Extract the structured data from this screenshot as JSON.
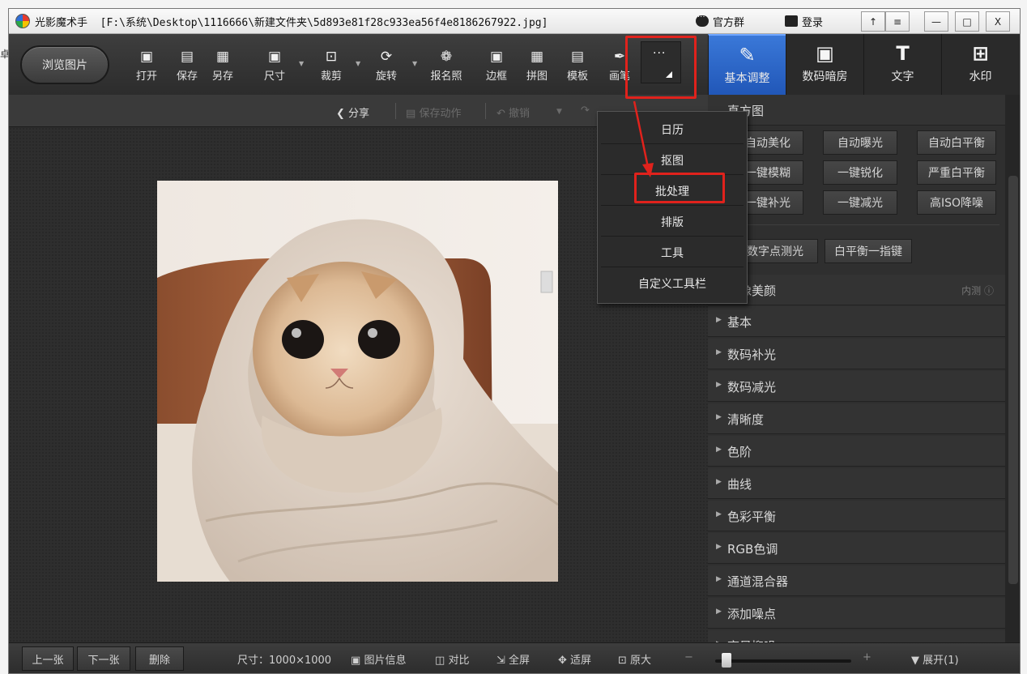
{
  "window": {
    "app_name": "光影魔术手",
    "file_path": "[F:\\系统\\Desktop\\1116666\\新建文件夹\\5d893e81f28c933ea56f4e8186267922.jpg]",
    "official_group": "官方群",
    "login": "登录",
    "controls": [
      "↑",
      "≡",
      "—",
      "□",
      "X"
    ]
  },
  "toolbar": {
    "browse": "浏览图片",
    "tools": [
      {
        "label": "打开",
        "icon": "open-icon"
      },
      {
        "label": "保存",
        "icon": "save-icon"
      },
      {
        "label": "另存",
        "icon": "save-as-icon"
      },
      {
        "label": "尺寸",
        "icon": "resize-icon"
      },
      {
        "label": "裁剪",
        "icon": "crop-icon"
      },
      {
        "label": "旋转",
        "icon": "rotate-icon"
      },
      {
        "label": "报名照",
        "icon": "id-photo-icon"
      },
      {
        "label": "边框",
        "icon": "border-icon"
      },
      {
        "label": "拼图",
        "icon": "collage-icon"
      },
      {
        "label": "模板",
        "icon": "template-icon"
      },
      {
        "label": "画笔",
        "icon": "brush-icon"
      }
    ],
    "more": "···"
  },
  "right_tabs": [
    {
      "label": "基本调整",
      "icon": "adjust-icon",
      "active": true
    },
    {
      "label": "数码暗房",
      "icon": "darkroom-icon",
      "active": false
    },
    {
      "label": "文字",
      "icon": "text-icon",
      "active": false
    },
    {
      "label": "水印",
      "icon": "watermark-icon",
      "active": false
    }
  ],
  "subbar": {
    "share": "分享",
    "save_action": "保存动作",
    "undo": "撤销"
  },
  "dropdown_menu": [
    "日历",
    "抠图",
    "批处理",
    "排版",
    "工具",
    "自定义工具栏"
  ],
  "right_panel": {
    "histogram_title": "直方图",
    "auto_buttons": [
      "自动美化",
      "自动曝光",
      "自动白平衡",
      "一键模糊",
      "一键锐化",
      "严重白平衡",
      "一键补光",
      "一键减光",
      "高ISO降噪"
    ],
    "metering_buttons": [
      "数字点测光",
      "白平衡一指键"
    ],
    "beauty_title": "人像美颜",
    "beauty_note": "内测",
    "sections": [
      "基本",
      "数码补光",
      "数码减光",
      "清晰度",
      "色阶",
      "曲线",
      "色彩平衡",
      "RGB色调",
      "通道混合器",
      "添加噪点",
      "夜景抑噪"
    ]
  },
  "bottombar": {
    "prev": "上一张",
    "next": "下一张",
    "delete": "删除",
    "size": "尺寸：1000×1000",
    "info": "图片信息",
    "compare": "对比",
    "fullscreen": "全屏",
    "fit": "适屏",
    "original": "原大",
    "zoom_minus": "−",
    "zoom_plus": "+",
    "expand": "展开(1)"
  },
  "colors": {
    "highlight_red": "#e0221c",
    "active_tab_blue": "#2f6fd8"
  }
}
